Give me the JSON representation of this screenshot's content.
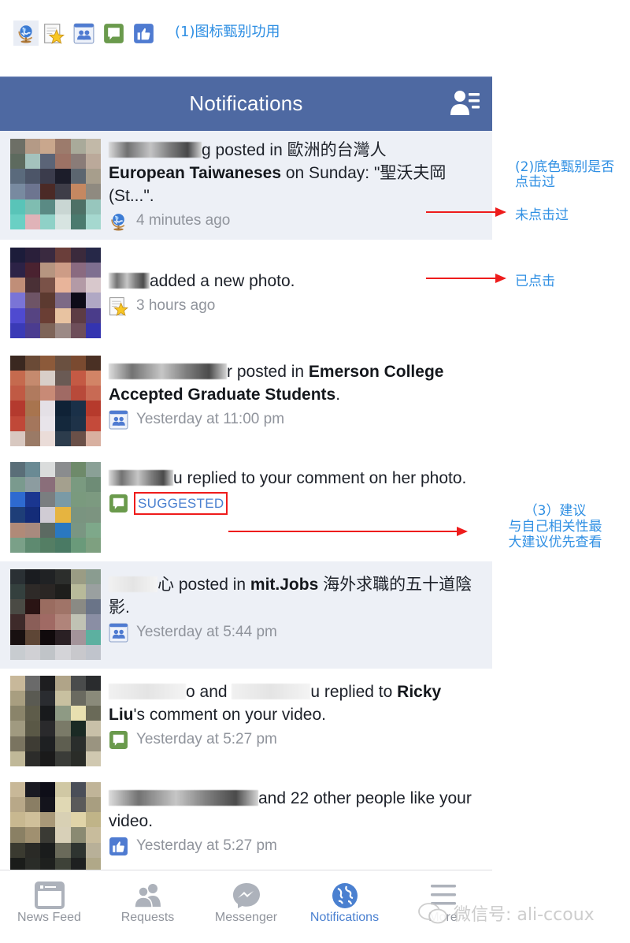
{
  "legend": {
    "icons": [
      "globe-icon",
      "star-page-icon",
      "group-icon",
      "comment-icon",
      "like-icon"
    ],
    "label": "(1)图标甄别功用"
  },
  "annotations": {
    "background_title_line1": "(2)底色甄别是否",
    "background_title_line2": "点击过",
    "unread_label": "未点击过",
    "read_label": "已点击",
    "suggest_title": "（3）建议",
    "suggest_line1": "与自己相关性最",
    "suggest_line2": "大建议优先查看",
    "arrow_color": "#ee1c1c",
    "text_color": "#2f8fe3"
  },
  "header": {
    "title": "Notifications",
    "right_icon": "friend-requests-icon",
    "bg_color": "#4e69a2"
  },
  "notifications": [
    {
      "state": "unread",
      "icon": "globe-icon",
      "name_tail": "g",
      "action": " posted in ",
      "bold": "歐洲的台灣人 European Taiwaneses",
      "rest": " on Sunday: \"聖沃夫岡(St...\".",
      "time": "4 minutes ago"
    },
    {
      "state": "read",
      "icon": "star-page-icon",
      "name_tail": "",
      "action": "added a new photo.",
      "time": "3 hours ago"
    },
    {
      "state": "read",
      "icon": "group-icon",
      "name_tail": "r",
      "action": " posted in ",
      "bold": "Emerson College Accepted Graduate Students",
      "rest": ".",
      "time": "Yesterday at 11:00 pm"
    },
    {
      "state": "read",
      "icon": "comment-icon",
      "name_tail": "u",
      "action": " replied to your comment on her photo.",
      "badge": "SUGGESTED"
    },
    {
      "state": "unread",
      "icon": "group-icon",
      "name_tail": "心",
      "action": " posted in ",
      "bold": "mit.Jobs",
      "rest": " 海外求職的五十道陰影.",
      "time": "Yesterday at 5:44 pm"
    },
    {
      "state": "read",
      "icon": "comment-icon",
      "name_tail": "o",
      "action": " and ",
      "name2_tail": "u",
      "action2": " replied to ",
      "bold": "Ricky Liu",
      "rest": "'s comment on your video.",
      "time": "Yesterday at 5:27 pm"
    },
    {
      "state": "read",
      "icon": "like-icon",
      "name_tail": "",
      "action": "and 22 other people like your video.",
      "time": "Yesterday at 5:27 pm"
    }
  ],
  "tabbar": {
    "tabs": [
      {
        "label": "News Feed",
        "icon": "news-feed-icon",
        "active": false
      },
      {
        "label": "Requests",
        "icon": "requests-icon",
        "active": false
      },
      {
        "label": "Messenger",
        "icon": "messenger-icon",
        "active": false
      },
      {
        "label": "Notifications",
        "icon": "notifications-globe-icon",
        "active": true
      },
      {
        "label": "More",
        "icon": "menu-icon",
        "active": false
      }
    ],
    "active_color": "#4a80d0",
    "inactive_color": "#90949c"
  },
  "watermark": "微信号: ali-ccoux"
}
